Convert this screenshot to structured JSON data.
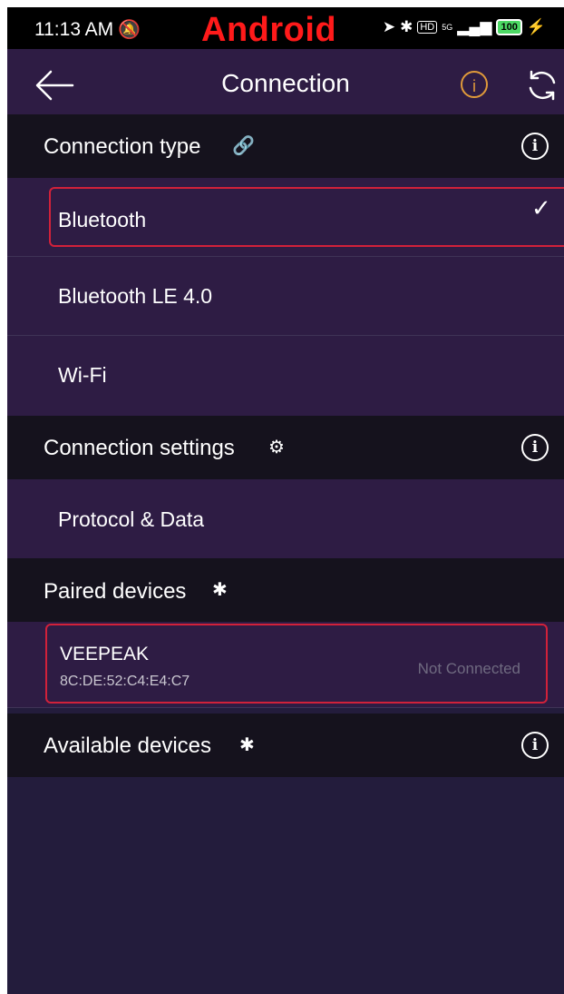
{
  "status_bar": {
    "time": "11:13 AM",
    "overlay_label": "Android",
    "network": "5G",
    "battery": "100"
  },
  "top_bar": {
    "title": "Connection",
    "info_label": "i"
  },
  "sections": {
    "connection_type": {
      "title": "Connection type",
      "info": "i",
      "options": [
        {
          "label": "Bluetooth",
          "selected": true
        },
        {
          "label": "Bluetooth LE 4.0",
          "selected": false
        },
        {
          "label": "Wi-Fi",
          "selected": false
        }
      ]
    },
    "connection_settings": {
      "title": "Connection settings",
      "info": "i",
      "items": [
        {
          "label": "Protocol & Data"
        }
      ]
    },
    "paired_devices": {
      "title": "Paired devices",
      "devices": [
        {
          "name": "VEEPEAK",
          "mac": "8C:DE:52:C4:E4:C7",
          "status": "Not Connected"
        }
      ]
    },
    "available_devices": {
      "title": "Available devices",
      "info": "i"
    }
  },
  "colors": {
    "background": "#231c3c",
    "row": "#2e1c44",
    "header": "#15121d",
    "highlight_border": "#d1213a",
    "info_accent": "#e09a3a"
  }
}
